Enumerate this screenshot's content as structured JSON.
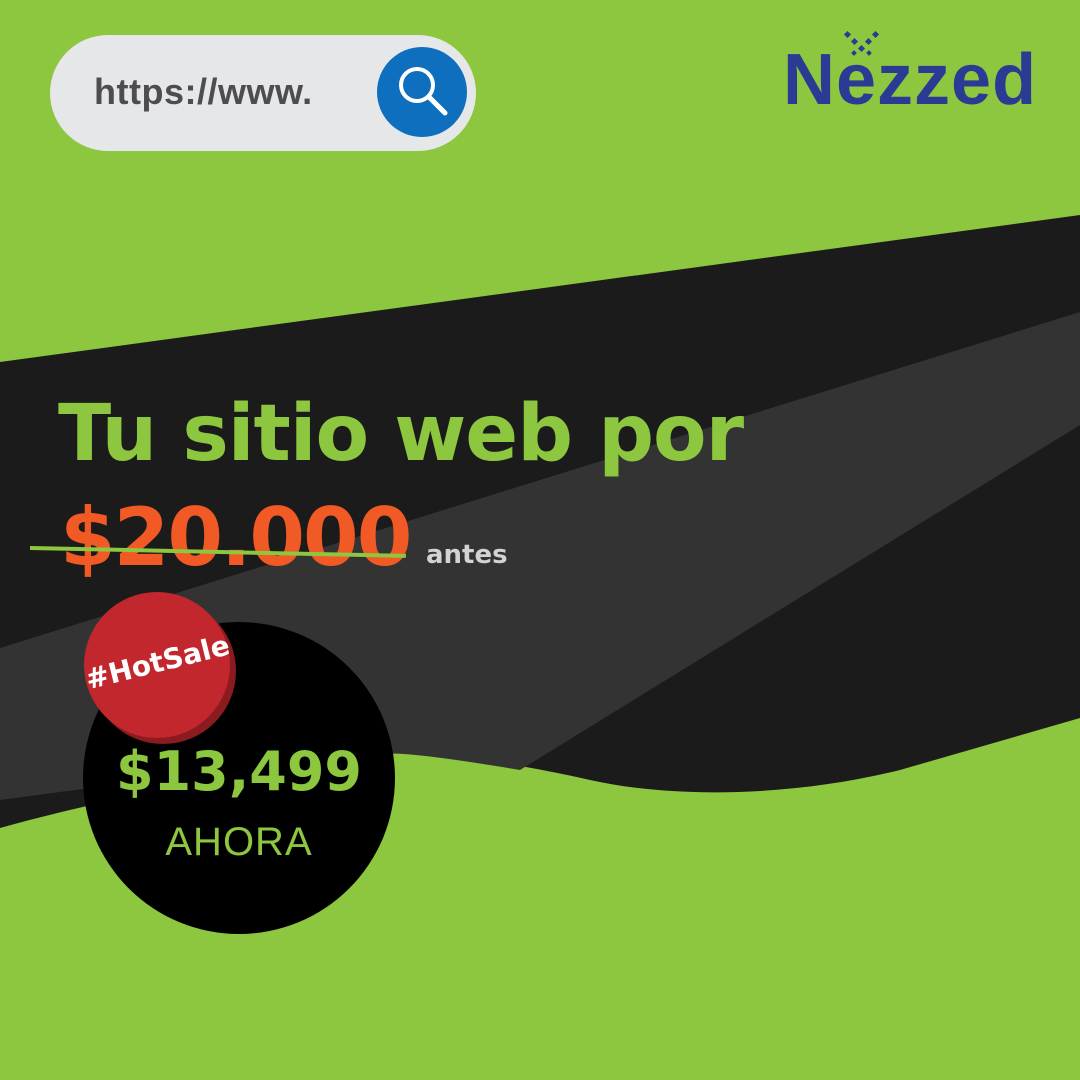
{
  "search": {
    "url_text": "https://www.",
    "icon": "search-icon"
  },
  "brand": {
    "name": "Nezzed",
    "color": "#2b3a92"
  },
  "headline": "Tu sitio web por",
  "pricing": {
    "old_price": "$20.000",
    "old_label": "antes",
    "badge": "#HotSale",
    "new_price": "$13,499",
    "new_label": "AHORA"
  },
  "colors": {
    "background_green": "#8dc63f",
    "band_dark": "#1b1b1b",
    "band_gray": "#333333",
    "old_price_orange": "#f15a24",
    "badge_red": "#c1272d",
    "search_blue": "#0d6fbd"
  }
}
